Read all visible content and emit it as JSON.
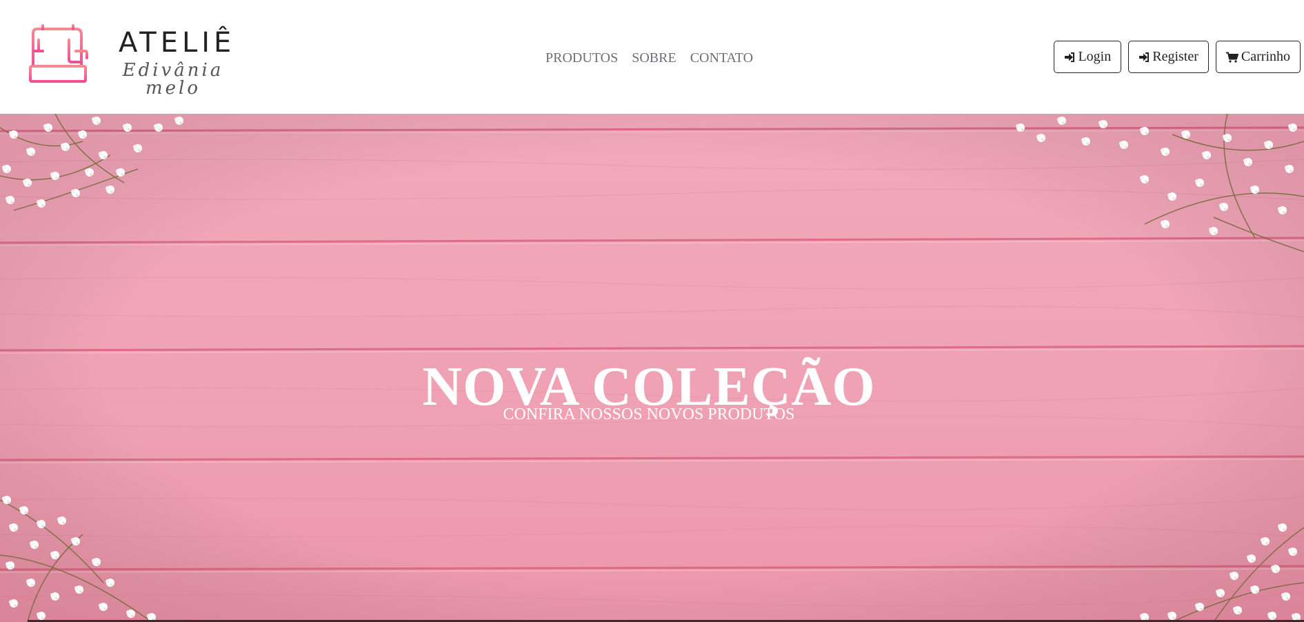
{
  "brand": {
    "title": "ATELIÊ",
    "subtitle": "Edivânia melo",
    "icon": "sewing-machine-icon"
  },
  "nav": {
    "items": [
      {
        "label": "PRODUTOS"
      },
      {
        "label": "SOBRE"
      },
      {
        "label": "CONTATO"
      }
    ]
  },
  "actions": {
    "login": {
      "label": "Login",
      "icon": "sign-in-icon"
    },
    "register": {
      "label": "Register",
      "icon": "sign-in-icon"
    },
    "cart": {
      "label": "Carrinho",
      "icon": "shopping-cart-icon"
    }
  },
  "hero": {
    "title": "NOVA COLEÇÃO",
    "subtitle": "CONFIRA NOSSOS NOVOS PRODUTOS"
  },
  "colors": {
    "hero_pink": "#f0a4b6",
    "plank_line": "#d9637f",
    "logo_gradient_top": "#f7898f",
    "logo_gradient_bottom": "#ee4f96",
    "nav_text": "#6b6f75"
  }
}
